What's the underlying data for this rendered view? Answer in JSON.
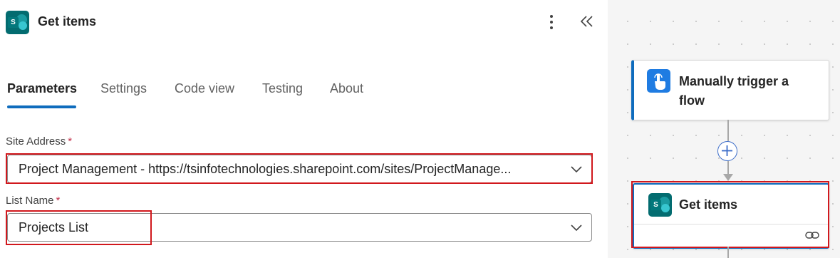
{
  "header": {
    "title": "Get items",
    "app_icon": "sharepoint-icon",
    "app_icon_letter": "S",
    "more_icon": "more-vertical-icon",
    "collapse_icon": "double-chevron-left-icon"
  },
  "tabs": [
    {
      "label": "Parameters",
      "active": true
    },
    {
      "label": "Settings",
      "active": false
    },
    {
      "label": "Code view",
      "active": false
    },
    {
      "label": "Testing",
      "active": false
    },
    {
      "label": "About",
      "active": false
    }
  ],
  "fields": {
    "site_address": {
      "label": "Site Address",
      "required_mark": "*",
      "value": "Project Management - https://tsinfotechnologies.sharepoint.com/sites/ProjectManage..."
    },
    "list_name": {
      "label": "List Name",
      "required_mark": "*",
      "value": "Projects List"
    }
  },
  "canvas": {
    "trigger_card": {
      "title": "Manually trigger a flow",
      "icon": "touch-icon"
    },
    "add_step_icon": "plus-icon",
    "action_card": {
      "title": "Get items",
      "icon": "sharepoint-icon",
      "icon_letter": "S",
      "footer_icon": "link-icon"
    }
  },
  "colors": {
    "accent": "#0f6cbd",
    "highlight": "#d1181d",
    "sharepoint": "#036c70",
    "trigger": "#1f7ce2",
    "required": "#c4314b"
  }
}
